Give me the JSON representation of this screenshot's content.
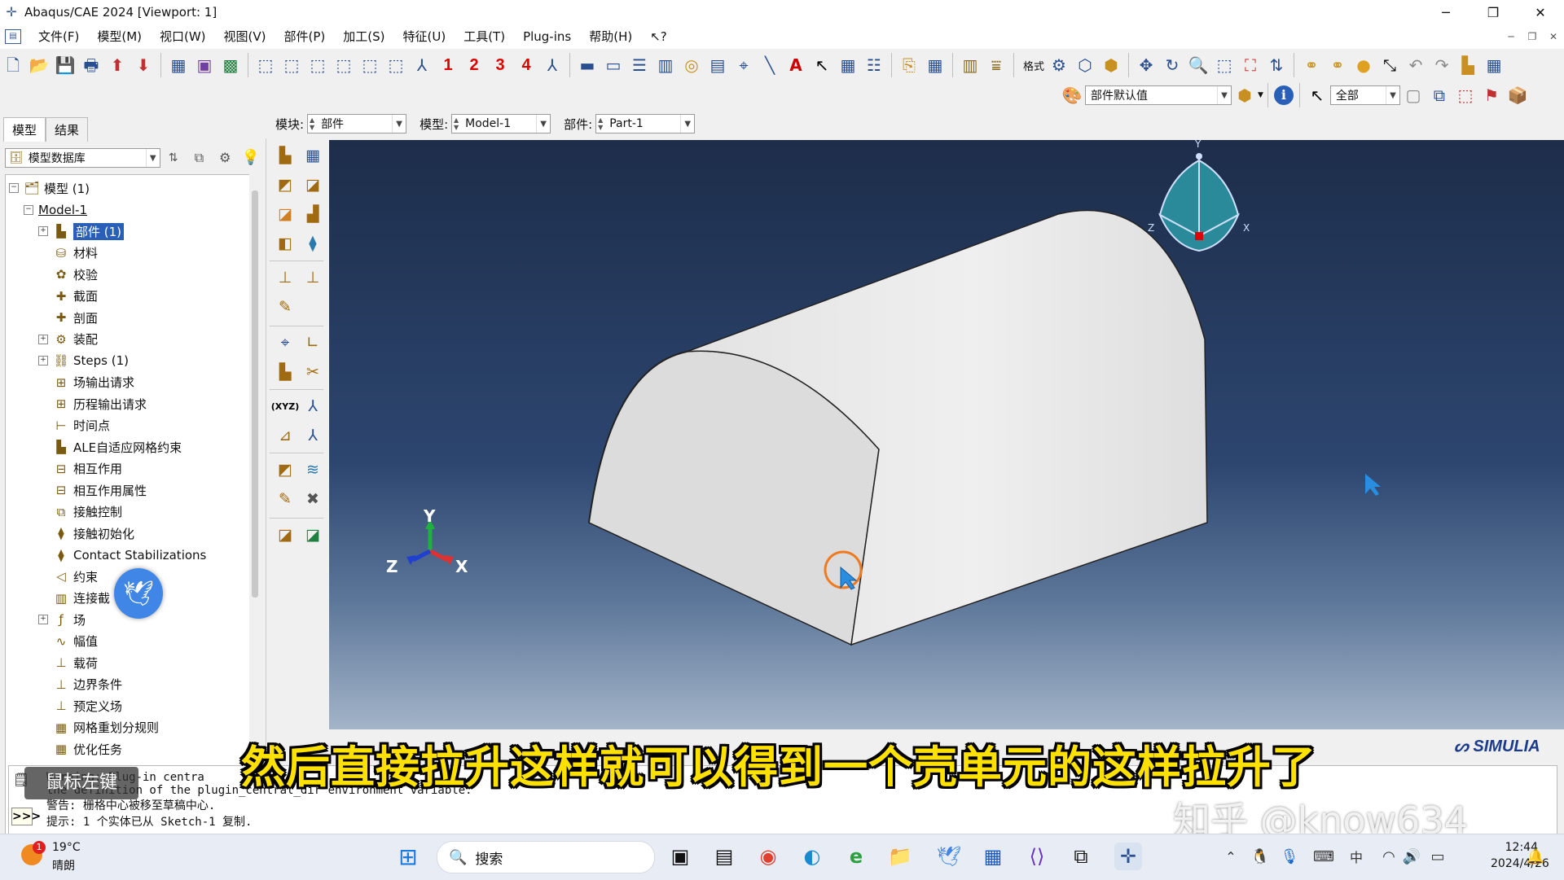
{
  "window": {
    "title": "Abaqus/CAE 2024 [Viewport: 1]"
  },
  "menu": [
    "文件(F)",
    "模型(M)",
    "视口(W)",
    "视图(V)",
    "部件(P)",
    "加工(S)",
    "特征(U)",
    "工具(T)",
    "Plug-ins",
    "帮助(H)",
    "↖?"
  ],
  "toolbar": {
    "view_numbers": [
      "1",
      "2",
      "3",
      "4"
    ],
    "format_label": "格式",
    "render_style": "部件默认值",
    "selection_filter": "全部"
  },
  "context": {
    "module_label": "模块:",
    "module_value": "部件",
    "model_label": "模型:",
    "model_value": "Model-1",
    "part_label": "部件:",
    "part_value": "Part-1"
  },
  "left_panel": {
    "tabs": [
      "模型",
      "结果"
    ],
    "database": "模型数据库",
    "tree": [
      {
        "label": "模型 (1)",
        "level": 0,
        "expander": "⊟",
        "icon": "model-tree-icon"
      },
      {
        "label": "Model-1",
        "level": 1,
        "expander": "⊟",
        "icon": "",
        "underline": true
      },
      {
        "label": "部件 (1)",
        "level": 2,
        "expander": "⊞",
        "icon": "parts-icon",
        "selected": true
      },
      {
        "label": "材料",
        "level": 2,
        "icon": "materials-icon"
      },
      {
        "label": "校验",
        "level": 2,
        "icon": "calibration-icon"
      },
      {
        "label": "截面",
        "level": 2,
        "icon": "sections-icon"
      },
      {
        "label": "剖面",
        "level": 2,
        "icon": "profiles-icon"
      },
      {
        "label": "装配",
        "level": 2,
        "expander": "⊞",
        "icon": "assembly-icon"
      },
      {
        "label": "Steps (1)",
        "level": 2,
        "expander": "⊞",
        "icon": "steps-icon"
      },
      {
        "label": "场输出请求",
        "level": 2,
        "icon": "field-output-icon"
      },
      {
        "label": "历程输出请求",
        "level": 2,
        "icon": "history-output-icon"
      },
      {
        "label": "时间点",
        "level": 2,
        "icon": "time-points-icon"
      },
      {
        "label": "ALE自适应网格约束",
        "level": 2,
        "icon": "ale-icon"
      },
      {
        "label": "相互作用",
        "level": 2,
        "icon": "interaction-icon"
      },
      {
        "label": "相互作用属性",
        "level": 2,
        "icon": "interaction-property-icon"
      },
      {
        "label": "接触控制",
        "level": 2,
        "icon": "contact-control-icon"
      },
      {
        "label": "接触初始化",
        "level": 2,
        "icon": "contact-init-icon"
      },
      {
        "label": "Contact Stabilizations",
        "level": 2,
        "icon": "contact-stab-icon"
      },
      {
        "label": "约束",
        "level": 2,
        "icon": "constraint-icon"
      },
      {
        "label": "连接截",
        "level": 2,
        "icon": "connector-icon"
      },
      {
        "label": "场",
        "level": 2,
        "expander": "⊞",
        "icon": "field-icon"
      },
      {
        "label": "幅值",
        "level": 2,
        "icon": "amplitude-icon"
      },
      {
        "label": "载荷",
        "level": 2,
        "icon": "load-icon"
      },
      {
        "label": "边界条件",
        "level": 2,
        "icon": "bc-icon"
      },
      {
        "label": "预定义场",
        "level": 2,
        "icon": "predefined-field-icon"
      },
      {
        "label": "网格重划分规则",
        "level": 2,
        "icon": "remesh-icon"
      },
      {
        "label": "优化任务",
        "level": 2,
        "icon": "optimization-icon"
      }
    ]
  },
  "viewport": {
    "triad_labels": {
      "x": "X",
      "y": "Y",
      "z": "Z"
    },
    "view_cube_labels": {
      "x": "X",
      "y": "Y",
      "z": "Z"
    },
    "brand": "SIMULIA"
  },
  "messages": {
    "line1": "Warning: Plug-in centra",
    "line2": "    the definition of the plugin_central_dir environment variable.",
    "line3": "警告: 栅格中心被移至草稿中心.",
    "line4": "提示: 1 个实体已从 Sketch-1 复制.",
    "mouse_hint": "鼠标左键",
    "prompt": ">>>"
  },
  "subtitle": "然后直接拉升这样就可以得到一个壳单元的这样拉升了",
  "watermark": "知乎 @know634",
  "taskbar": {
    "weather_temp": "19°C",
    "weather_desc": "晴朗",
    "weather_badge": "1",
    "search_placeholder": "搜索",
    "time": "12:44",
    "date": "2024/4/26"
  },
  "colors": {
    "subtitle": "#ffe100",
    "selection": "#2a5fb8",
    "viewport_top": "#1d2d4a",
    "viewport_bottom": "#a3b4c8"
  }
}
